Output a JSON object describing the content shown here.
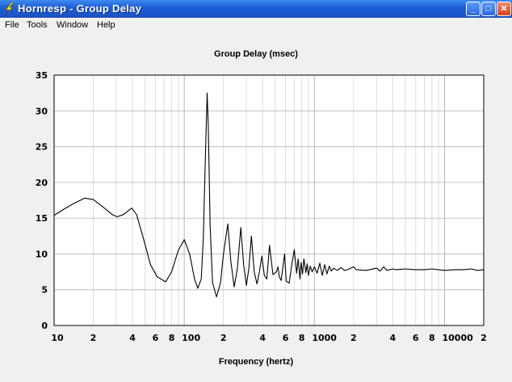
{
  "window": {
    "title": "Hornresp - Group Delay",
    "minimize": "_",
    "maximize": "□",
    "close": "✕"
  },
  "menu": [
    "File",
    "Tools",
    "Window",
    "Help"
  ],
  "chart_data": {
    "type": "line",
    "title": "Group Delay (msec)",
    "xlabel": "Frequency (hertz)",
    "ylabel": "",
    "xscale": "log",
    "xlim": [
      10,
      20000
    ],
    "ylim": [
      0,
      35
    ],
    "grid": true,
    "yticks": [
      0,
      5,
      10,
      15,
      20,
      25,
      30,
      35
    ],
    "xticks": [
      {
        "value": 10,
        "label": "10"
      },
      {
        "value": 20,
        "label": "2"
      },
      {
        "value": 40,
        "label": "4"
      },
      {
        "value": 60,
        "label": "6"
      },
      {
        "value": 80,
        "label": "8"
      },
      {
        "value": 100,
        "label": "100"
      },
      {
        "value": 200,
        "label": "2"
      },
      {
        "value": 400,
        "label": "4"
      },
      {
        "value": 600,
        "label": "6"
      },
      {
        "value": 800,
        "label": "8"
      },
      {
        "value": 1000,
        "label": "1000"
      },
      {
        "value": 2000,
        "label": "2"
      },
      {
        "value": 4000,
        "label": "4"
      },
      {
        "value": 6000,
        "label": "6"
      },
      {
        "value": 8000,
        "label": "8"
      },
      {
        "value": 10000,
        "label": "10000"
      },
      {
        "value": 20000,
        "label": "2"
      }
    ],
    "series": [
      {
        "name": "Group Delay",
        "x": [
          10,
          12,
          14,
          17.2,
          20,
          24,
          28,
          30.5,
          34,
          39.5,
          43,
          48,
          55,
          62,
          72,
          80,
          90,
          100,
          110,
          120,
          127,
          135,
          140,
          145,
          150,
          153,
          158,
          165,
          177,
          190,
          200,
          216,
          228,
          242,
          256,
          272,
          286,
          300,
          314,
          328,
          345,
          362,
          378,
          395,
          412,
          430,
          440,
          452,
          480,
          510,
          525,
          538,
          555,
          572,
          590,
          607,
          640,
          670,
          700,
          730,
          750,
          775,
          790,
          810,
          830,
          860,
          880,
          900,
          930,
          960,
          1000,
          1050,
          1100,
          1150,
          1200,
          1250,
          1300,
          1350,
          1400,
          1500,
          1600,
          1700,
          1800,
          2000,
          2100,
          2500,
          3000,
          3200,
          3400,
          3600,
          4000,
          4200,
          5000,
          6000,
          7000,
          8000,
          10000,
          12000,
          14000,
          16000,
          18000,
          20000
        ],
        "y": [
          15.4,
          16.3,
          17.0,
          17.8,
          17.6,
          16.5,
          15.5,
          15.2,
          15.5,
          16.4,
          15.5,
          12.5,
          8.5,
          6.8,
          6.1,
          7.5,
          10.5,
          12.0,
          10.0,
          6.5,
          5.2,
          6.5,
          12.0,
          23.0,
          32.5,
          28.0,
          14.0,
          6.0,
          4.0,
          6.0,
          10.0,
          14.2,
          9.0,
          5.4,
          8.0,
          13.7,
          8.5,
          5.6,
          8.0,
          12.5,
          7.5,
          5.8,
          7.5,
          9.7,
          7.0,
          6.5,
          8.5,
          11.2,
          7.1,
          7.5,
          8.2,
          6.8,
          6.3,
          8.0,
          10.0,
          6.2,
          5.9,
          8.5,
          10.6,
          7.3,
          9.3,
          6.5,
          8.8,
          7.2,
          9.3,
          7.4,
          8.6,
          7.0,
          8.3,
          7.5,
          8.2,
          7.3,
          8.7,
          7.0,
          8.5,
          7.2,
          8.3,
          7.6,
          8.0,
          7.7,
          8.1,
          7.7,
          7.8,
          8.2,
          7.8,
          7.7,
          8.0,
          7.6,
          8.2,
          7.7,
          7.9,
          7.8,
          7.9,
          7.8,
          7.8,
          7.9,
          7.7,
          7.8,
          7.8,
          7.9,
          7.7,
          7.8
        ]
      }
    ]
  }
}
